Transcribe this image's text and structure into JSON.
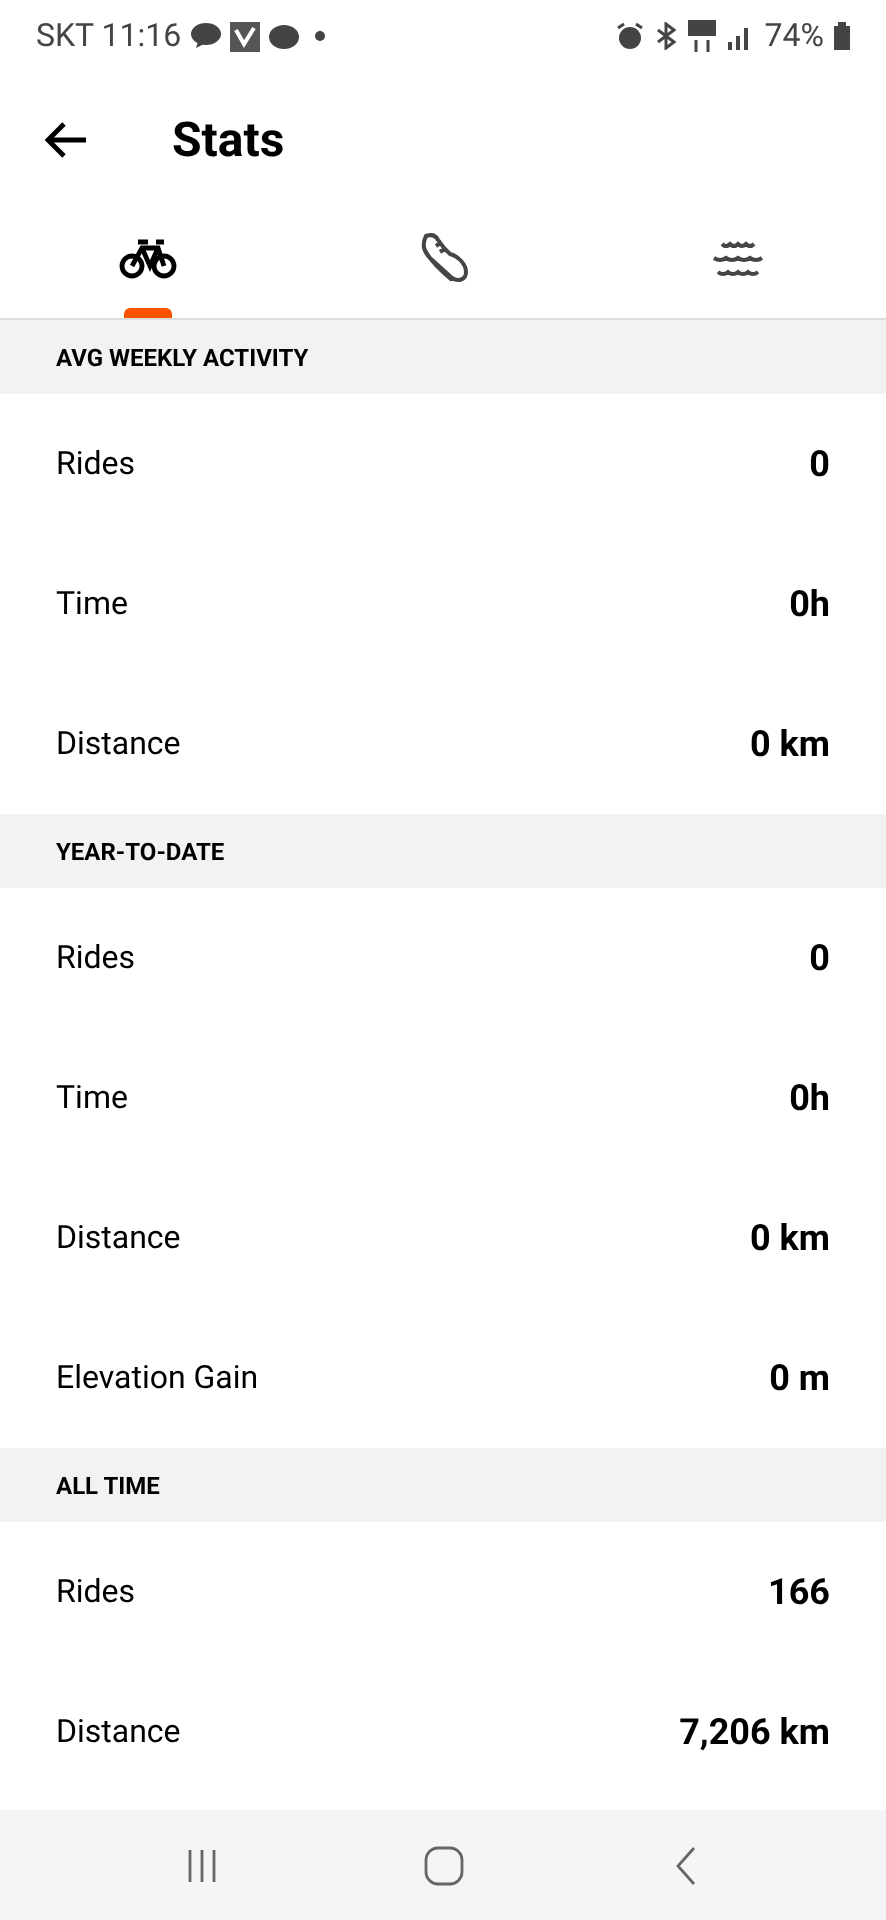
{
  "status_bar": {
    "carrier_time": "SKT 11:16",
    "battery": "74%"
  },
  "header": {
    "title": "Stats"
  },
  "tabs": [
    {
      "kind": "ride",
      "selected": true
    },
    {
      "kind": "run",
      "selected": false
    },
    {
      "kind": "swim",
      "selected": false
    }
  ],
  "sections": [
    {
      "title": "AVG WEEKLY ACTIVITY",
      "rows": [
        {
          "label": "Rides",
          "value": "0"
        },
        {
          "label": "Time",
          "value": "0h"
        },
        {
          "label": "Distance",
          "value": "0 km"
        }
      ]
    },
    {
      "title": "YEAR-TO-DATE",
      "rows": [
        {
          "label": "Rides",
          "value": "0"
        },
        {
          "label": "Time",
          "value": "0h"
        },
        {
          "label": "Distance",
          "value": "0 km"
        },
        {
          "label": "Elevation Gain",
          "value": "0 m"
        }
      ]
    },
    {
      "title": "ALL TIME",
      "rows": [
        {
          "label": "Rides",
          "value": "166"
        },
        {
          "label": "Distance",
          "value": "7,206 km"
        }
      ]
    }
  ]
}
